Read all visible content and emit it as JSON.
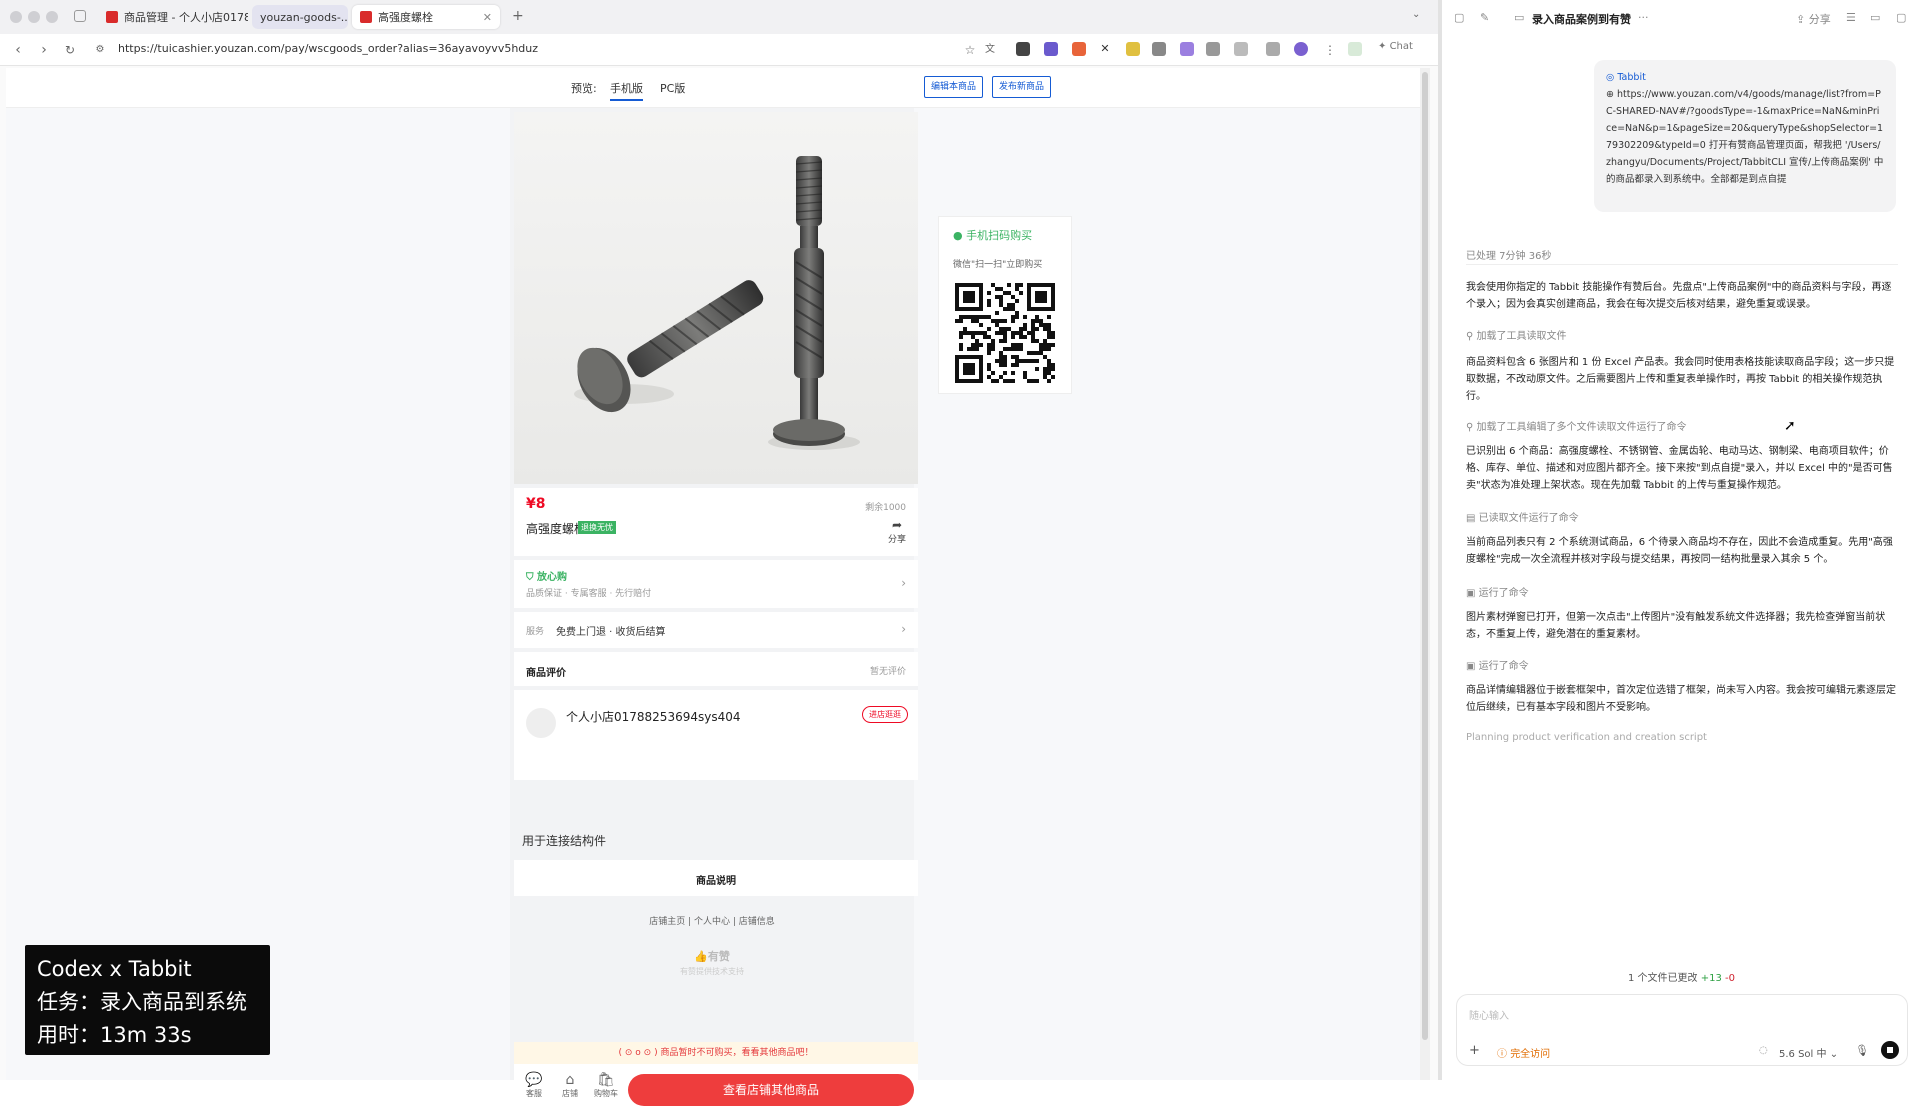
{
  "browser": {
    "tabs": [
      {
        "label": "商品管理 - 个人小店01788253..."
      },
      {
        "label": "youzan-goods-..."
      },
      {
        "label": "高强度螺栓"
      }
    ],
    "url": "https://tuicashier.youzan.com/pay/wscgoods_order?alias=36ayavoyvv5hduz",
    "chat_label": "Chat"
  },
  "preview": {
    "label": "预览:",
    "tabs": [
      "手机版",
      "PC版"
    ],
    "edit_button": "编辑本商品",
    "publish_button": "发布新商品"
  },
  "product": {
    "price": "¥8",
    "stock": "剩余1000",
    "name": "高强度螺栓",
    "badge": "退换无忧",
    "share": "分享",
    "guarantee_title": "放心购",
    "guarantee_items": "品质保证 · 专属客服 · 先行赔付",
    "service_label": "服务",
    "service_value": "免费上门退 · 收货后结算",
    "review_title": "商品评价",
    "review_status": "暂无评价",
    "shop_name": "个人小店01788253694sys404",
    "shop_button": "进店逛逛",
    "description": "用于连接结构件",
    "desc_title": "商品说明",
    "footer_links": "店铺主页 | 个人中心 | 店铺信息",
    "youzan_logo": "有赞",
    "youzan_support": "有赞提供技术支持",
    "banner": "( ⊙ o ⊙ ) 商品暂时不可购买，看看其他商品吧！",
    "bottom_tabs": [
      "客服",
      "店铺",
      "购物车"
    ],
    "main_button": "查看店铺其他商品"
  },
  "qr": {
    "title": "手机扫码购买",
    "subtitle": "微信\"扫一扫\"立即购买"
  },
  "overlay": {
    "line1": "Codex x Tabbit",
    "line2": "任务：录入商品到系统",
    "line3": "用时：13m 33s"
  },
  "panel": {
    "title": "录入商品案例到有赞",
    "share": "分享",
    "user_title": "Tabbit",
    "user_text": "https://www.youzan.com/v4/goods/manage/list?from=PC-SHARED-NAV#/?goodsType=-1&maxPrice=NaN&minPrice=NaN&p=1&pageSize=20&queryType&shopSelector=179302209&typeId=0 打开有赞商品管理页面，帮我把 '/Users/zhangyu/Documents/Project/TabbitCLI 宣传/上传商品案例' 中的商品都录入到系统中。全部都是到点自提",
    "processed": "已处理 7分钟 36秒",
    "p1": "我会使用你指定的 Tabbit 技能操作有赞后台。先盘点\"上传商品案例\"中的商品资料与字段，再逐个录入；因为会真实创建商品，我会在每次提交后核对结果，避免重复或误录。",
    "t1": "加载了工具读取文件",
    "p2": "商品资料包含 6 张图片和 1 份 Excel 产品表。我会同时使用表格技能读取商品字段；这一步只提取数据，不改动原文件。之后需要图片上传和重复表单操作时，再按 Tabbit 的相关操作规范执行。",
    "t2": "加载了工具编辑了多个文件读取文件运行了命令",
    "p3": "已识别出 6 个商品：高强度螺栓、不锈钢管、金属齿轮、电动马达、钢制梁、电商项目软件；价格、库存、单位、描述和对应图片都齐全。接下来按\"到点自提\"录入，并以 Excel 中的\"是否可售卖\"状态为准处理上架状态。现在先加载 Tabbit 的上传与重复操作规范。",
    "t3": "已读取文件运行了命令",
    "p4": "当前商品列表只有 2 个系统测试商品，6 个待录入商品均不存在，因此不会造成重复。先用\"高强度螺栓\"完成一次全流程并核对字段与提交结果，再按同一结构批量录入其余 5 个。",
    "t4": "运行了命令",
    "p5": "图片素材弹窗已打开，但第一次点击\"上传图片\"没有触发系统文件选择器；我先检查弹窗当前状态，不重复上传，避免潜在的重复素材。",
    "t5": "运行了命令",
    "p6": "商品详情编辑器位于嵌套框架中，首次定位选错了框架，尚未写入内容。我会按可编辑元素逐层定位后继续，已有基本字段和图片不受影响。",
    "planning": "Planning product verification and creation script",
    "changes_text": "1 个文件已更改",
    "changes_plus": "+13",
    "changes_minus": "-0",
    "input_placeholder": "随心输入",
    "access": "完全访问",
    "model": "5.6 Sol 中"
  }
}
